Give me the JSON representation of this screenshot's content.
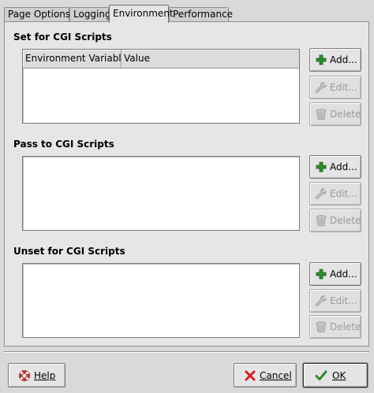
{
  "tabs": [
    {
      "label": "Page Options",
      "active": false
    },
    {
      "label": "Logging",
      "active": false
    },
    {
      "label": "Environment",
      "active": true
    },
    {
      "label": "Performance",
      "active": false
    }
  ],
  "sections": {
    "set": {
      "title": "Set for CGI Scripts",
      "columns": [
        "Environment Variable",
        "Value"
      ],
      "add": "Add...",
      "edit": "Edit...",
      "delete": "Delete"
    },
    "pass": {
      "title": "Pass to CGI Scripts",
      "add": "Add...",
      "edit": "Edit...",
      "delete": "Delete"
    },
    "unset": {
      "title": "Unset for CGI Scripts",
      "add": "Add...",
      "edit": "Edit...",
      "delete": "Delete"
    }
  },
  "footer": {
    "help": "Help",
    "cancel": "Cancel",
    "ok": "OK"
  },
  "colors": {
    "add_green": "#2e8b2e",
    "cancel_red": "#cc2222",
    "ok_green": "#2e8b2e",
    "help_red": "#c8372d"
  }
}
